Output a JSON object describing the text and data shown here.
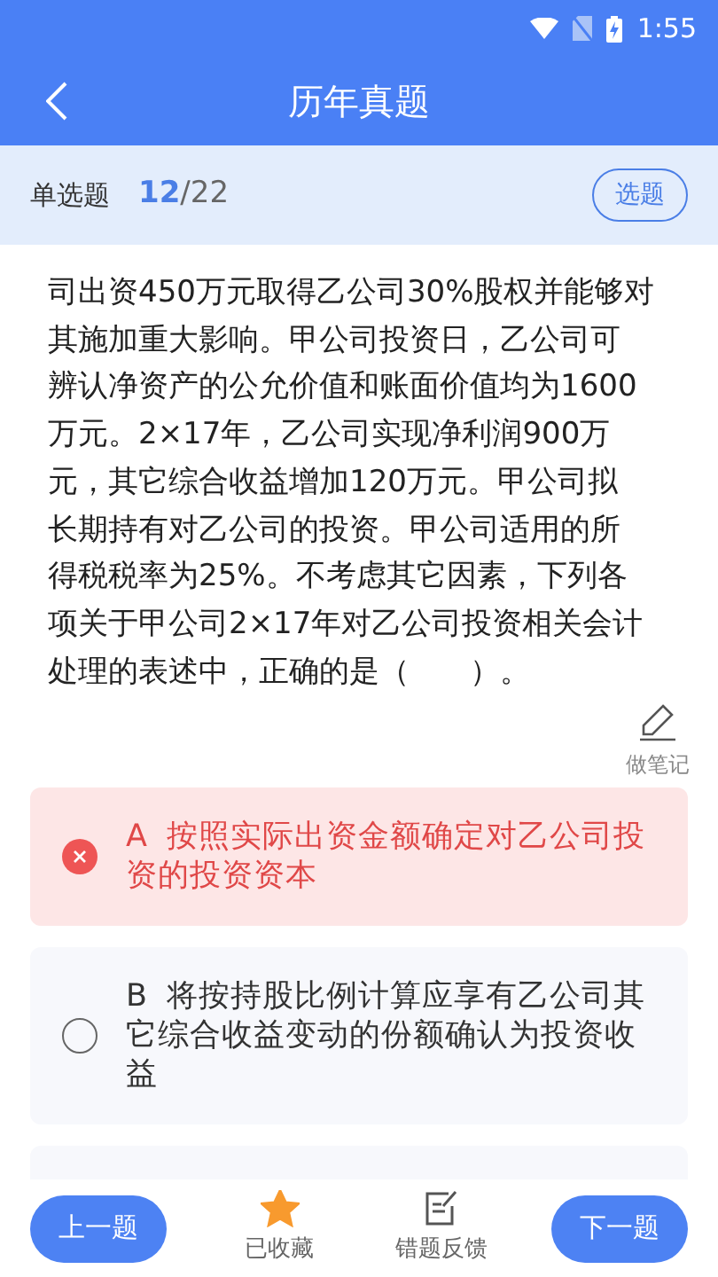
{
  "status_bar": {
    "time": "1:55"
  },
  "header": {
    "title": "历年真题"
  },
  "sub_bar": {
    "type": "单选题",
    "current": "12",
    "total": "/22",
    "pick_button": "选题"
  },
  "question": {
    "lines": [
      "司出资450万元取得乙公司30%股权并能够对",
      "其施加重大影响。甲公司投资日，乙公司可",
      "辨认净资产的公允价值和账面价值均为1600",
      "万元。2×17年，乙公司实现净利润900万",
      "元，其它综合收益增加120万元。甲公司拟",
      "长期持有对乙公司的投资。甲公司适用的所",
      "得税税率为25%。不考虑其它因素，下列各",
      "项关于甲公司2×17年对乙公司投资相关会计",
      "处理的表述中，正确的是（　　）。"
    ],
    "note_label": "做笔记"
  },
  "options": [
    {
      "letter": "A",
      "text": "按照实际出资金额确定对乙公司投资的投资资本",
      "wrong": true
    },
    {
      "letter": "B",
      "text": "将按持股比例计算应享有乙公司其它综合收益变动的份额确认为投资收益",
      "wrong": false
    }
  ],
  "bottom_bar": {
    "prev": "上一题",
    "favorite": {
      "label": "已收藏",
      "on": true
    },
    "feedback": "错题反馈",
    "next": "下一题"
  }
}
